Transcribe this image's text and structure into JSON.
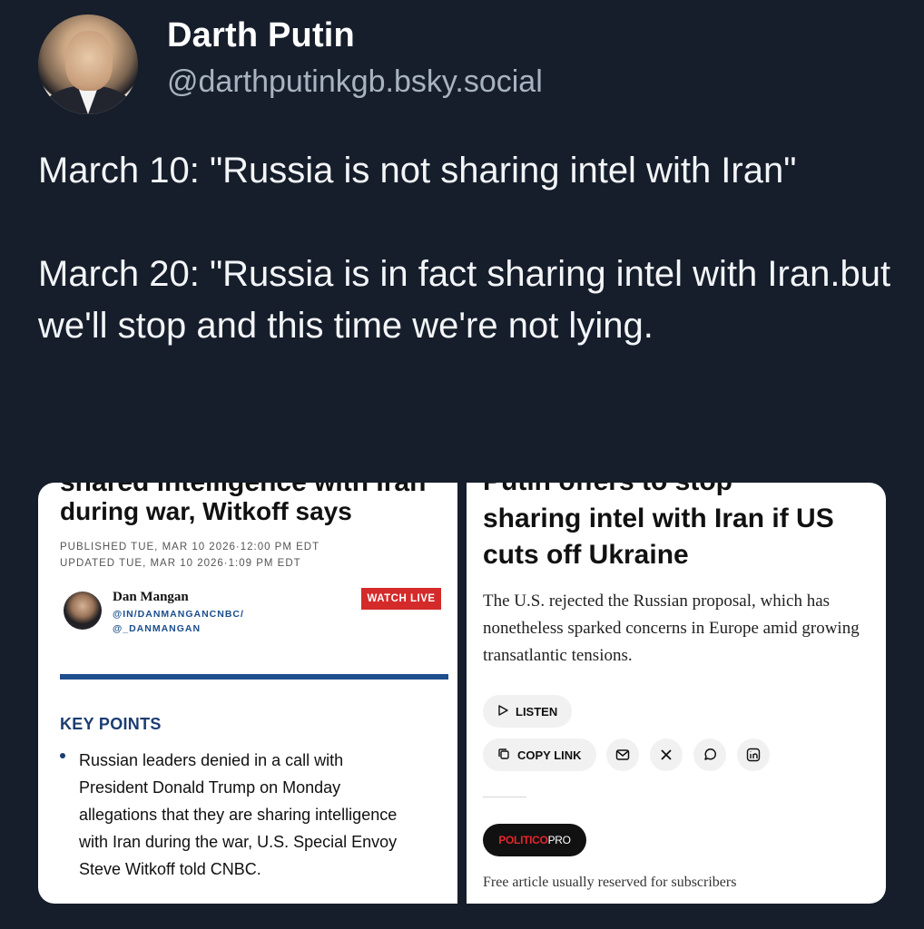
{
  "author": {
    "display_name": "Darth Putin",
    "handle": "@darthputinkgb.bsky.social"
  },
  "post": {
    "text": "March 10: \"Russia is not sharing intel with Iran\"\n\nMarch 20: \"Russia is in fact sharing intel with Iran.but we'll stop and this time we're not lying."
  },
  "images": {
    "left": {
      "cut_headline": "shared intelligence with Iran",
      "headline": "during war, Witkoff says",
      "published": "PUBLISHED TUE, MAR 10 2026·12:00 PM EDT",
      "updated": "UPDATED TUE, MAR 10 2026·1:09 PM EDT",
      "author_name": "Dan Mangan",
      "author_linkedin": "@IN/DANMANGANCNBC/",
      "author_twitter": "@_DANMANGAN",
      "watch_live": "WATCH LIVE",
      "key_points": "KEY POINTS",
      "bullet": "Russian leaders denied in a call with President Donald Trump on Monday allegations that they are sharing intelligence with Iran during the war, U.S. Special Envoy Steve Witkoff told CNBC."
    },
    "right": {
      "cut_headline": "Putin offers to stop",
      "headline": "sharing intel with Iran if US cuts off Ukraine",
      "dek": "The U.S. rejected the Russian proposal, which has nonetheless sparked concerns in Europe amid growing transatlantic tensions.",
      "listen": "LISTEN",
      "copy_link": "COPY LINK",
      "share_icons": [
        "mail-icon",
        "x-icon",
        "whatsapp-icon",
        "linkedin-icon"
      ],
      "politico_brand": "POLITICO",
      "politico_pro": "PRO",
      "free_article": "Free article usually reserved for subscribers"
    }
  },
  "colors": {
    "background": "#161e2b",
    "handle": "#a8b3c2",
    "cnbc_blue": "#1f4e8c",
    "watch_live_red": "#d42a2a",
    "politico_red": "#e3262b"
  }
}
